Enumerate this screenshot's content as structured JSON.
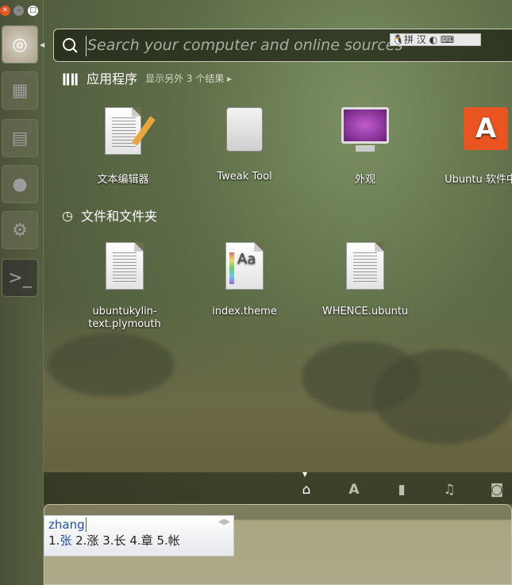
{
  "window": {
    "close": "×",
    "minimize": "–",
    "maximize": "□"
  },
  "launcher": {
    "items": [
      "dash-home",
      "files",
      "file-cabinet",
      "firefox",
      "system-settings",
      "terminal"
    ]
  },
  "search": {
    "placeholder": "Search your computer and online sources",
    "ime_indicator": "拼 汉"
  },
  "apps": {
    "title": "应用程序",
    "more": "显示另外 3 个结果",
    "items": [
      {
        "label": "文本编辑器",
        "icon": "text-editor-icon"
      },
      {
        "label": "Tweak Tool",
        "icon": "tweak-tool-icon"
      },
      {
        "label": "外观",
        "icon": "appearance-icon"
      },
      {
        "label": "Ubuntu 软件中心",
        "icon": "software-center-icon"
      }
    ]
  },
  "files": {
    "title": "文件和文件夹",
    "items": [
      {
        "label": "ubuntukylin-text.plymouth"
      },
      {
        "label": "index.theme"
      },
      {
        "label": "WHENCE.ubuntu"
      }
    ]
  },
  "lenses": [
    "home",
    "applications",
    "files",
    "music",
    "photos"
  ],
  "ime": {
    "input": "zhang",
    "candidates": [
      {
        "n": "1.",
        "c": "张"
      },
      {
        "n": "2.",
        "c": "涨"
      },
      {
        "n": "3.",
        "c": "长"
      },
      {
        "n": "4.",
        "c": "章"
      },
      {
        "n": "5.",
        "c": "帐"
      }
    ]
  },
  "colors": {
    "accent": "#e95420",
    "highlight": "#1f4fa8"
  }
}
